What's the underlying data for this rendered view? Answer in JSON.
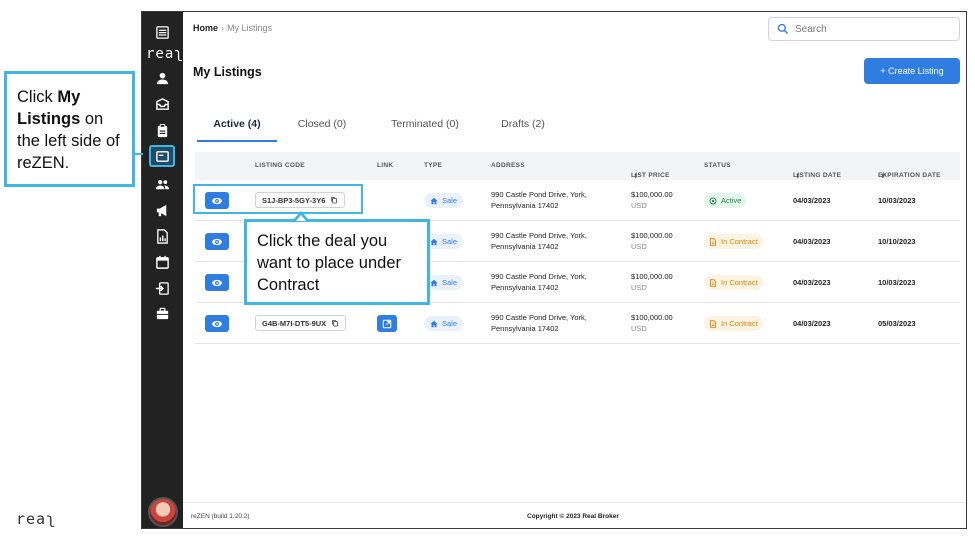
{
  "brand": "reaʅ",
  "corner_logo": "reaʅ",
  "sidebar": {
    "items": [
      {
        "name": "menu-icon"
      },
      {
        "name": "user-icon"
      },
      {
        "name": "inbox-icon"
      },
      {
        "name": "clipboard-icon"
      },
      {
        "name": "listings-icon",
        "active": true
      },
      {
        "name": "team-icon"
      },
      {
        "name": "megaphone-icon"
      },
      {
        "name": "report-icon"
      },
      {
        "name": "calendar-icon"
      },
      {
        "name": "login-icon"
      },
      {
        "name": "briefcase-icon"
      }
    ]
  },
  "breadcrumb": {
    "home": "Home",
    "separator": "›",
    "current": "My Listings"
  },
  "search": {
    "placeholder": "Search"
  },
  "page": {
    "title": "My Listings",
    "create_label": "+ Create Listing"
  },
  "tabs": [
    {
      "label": "Active (4)",
      "active": true
    },
    {
      "label": "Closed (0)"
    },
    {
      "label": "Terminated (0)"
    },
    {
      "label": "Drafts (2)"
    }
  ],
  "table": {
    "headers": {
      "code": "LISTING CODE",
      "link": "LINK",
      "type": "TYPE",
      "address": "ADDRESS",
      "price": "LIST PRICE",
      "status": "STATUS",
      "listing_date": "LISTING DATE",
      "expiration_date": "EXPIRATION DATE",
      "sort_glyph": "⬍"
    },
    "rows": [
      {
        "code": "S1J-BP3-5GY-3Y6",
        "type": "Sale",
        "address": "990 Castle Pond Drive, York, Pennsylvania 17402",
        "price": "$100,000.00",
        "currency": "USD",
        "status": "Active",
        "status_kind": "ok",
        "listing_date": "04/03/2023",
        "expiration_date": "10/03/2023"
      },
      {
        "code": "",
        "type": "Sale",
        "address": "990 Castle Pond Drive, York, Pennsylvania 17402",
        "price": "$100,000.00",
        "currency": "USD",
        "status": "In Contract",
        "status_kind": "wait",
        "listing_date": "04/03/2023",
        "expiration_date": "10/10/2023"
      },
      {
        "code": "",
        "type": "Sale",
        "address": "990 Castle Pond Drive, York, Pennsylvania 17402",
        "price": "$100,000.00",
        "currency": "USD",
        "status": "In Contract",
        "status_kind": "wait",
        "listing_date": "04/03/2023",
        "expiration_date": "10/03/2023"
      },
      {
        "code": "G4B-M7I-DT5-9UX",
        "type": "Sale",
        "address": "990 Castle Pond Drive, York, Pennsylvania 17402",
        "price": "$100,000.00",
        "currency": "USD",
        "status": "In Contract",
        "status_kind": "wait",
        "listing_date": "04/03/2023",
        "expiration_date": "05/03/2023",
        "has_link": true
      }
    ]
  },
  "footer": {
    "build": "reZEN (build 1.20.2)",
    "copyright": "Copyright © 2023 Real Broker"
  },
  "callouts": {
    "left": {
      "pre": "Click ",
      "bold": "My Listings",
      "post": " on the left side of reZEN."
    },
    "deal": "Click the deal you want to place under Contract"
  },
  "colors": {
    "accent": "#2f7de1",
    "callout": "#3fb6e4",
    "sidebar": "#222222",
    "active": "#1e8a45",
    "in_contract": "#d2870e"
  }
}
